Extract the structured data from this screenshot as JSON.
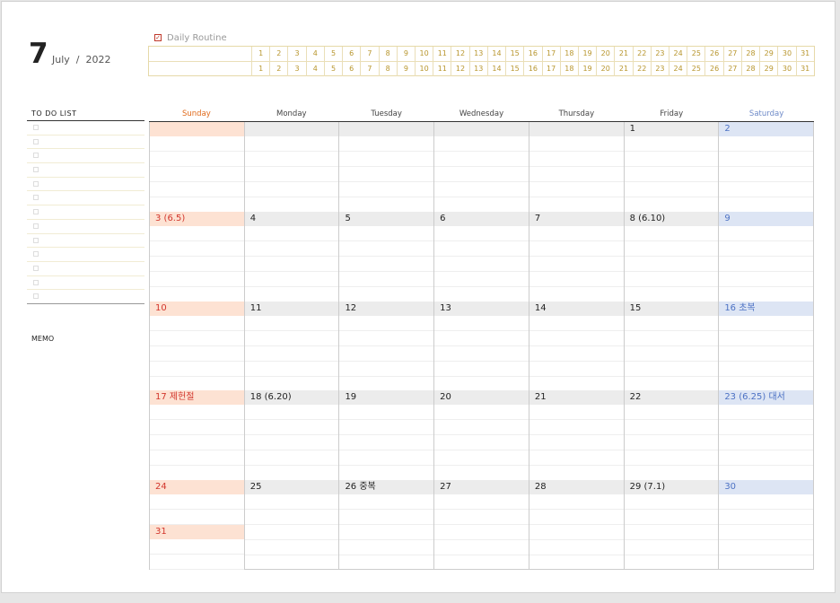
{
  "header": {
    "month_number": "7",
    "month_year": "July  /  2022"
  },
  "routine": {
    "title": "Daily Routine",
    "check_glyph": "✓",
    "days": [
      "1",
      "2",
      "3",
      "4",
      "5",
      "6",
      "7",
      "8",
      "9",
      "10",
      "11",
      "12",
      "13",
      "14",
      "15",
      "16",
      "17",
      "18",
      "19",
      "20",
      "21",
      "22",
      "23",
      "24",
      "25",
      "26",
      "27",
      "28",
      "29",
      "30",
      "31"
    ]
  },
  "todo": {
    "title": "TO  DO  LIST",
    "item_count": 13
  },
  "memo": {
    "title": "MEMO"
  },
  "calendar": {
    "weekdays": [
      "Sunday",
      "Monday",
      "Tuesday",
      "Wednesday",
      "Thursday",
      "Friday",
      "Saturday"
    ],
    "weeks": [
      [
        "",
        "",
        "",
        "",
        "",
        "1",
        "2"
      ],
      [
        "3  (6.5)",
        "4",
        "5",
        "6",
        "7",
        "8  (6.10)",
        "9"
      ],
      [
        "10",
        "11",
        "12",
        "13",
        "14",
        "15",
        "16  초복"
      ],
      [
        "17  제헌절",
        "18  (6.20)",
        "19",
        "20",
        "21",
        "22",
        "23  (6.25)  대서"
      ],
      [
        "24",
        "25",
        "26  중복",
        "27",
        "28",
        "29  (7.1)",
        "30"
      ]
    ],
    "extra_sunday": "31"
  },
  "colors": {
    "sunday_text": "#d2362c",
    "sunday_bg": "#fde2d3",
    "saturday_text": "#4d72c4",
    "saturday_bg": "#dde5f4",
    "routine_accent": "#b8962e"
  }
}
